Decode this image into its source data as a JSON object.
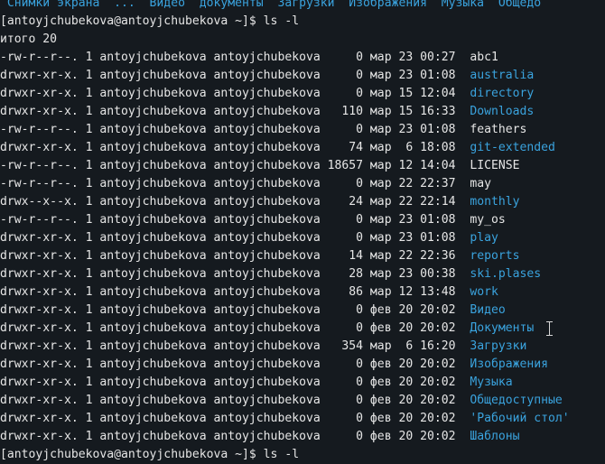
{
  "prev_line": " Снимки экрана  ...  Видео  документы  Загрузки  Изображения  Музыка  Общедо",
  "prompt": "[antoyjchubekova@antoyjchubekova ~]$ ls -l",
  "total": "итого 20",
  "rows": [
    {
      "meta": "-rw-r--r--. 1 antoyjchubekova antoyjchubekova     0 мар 23 00:27",
      "name": "abc1",
      "type": "file"
    },
    {
      "meta": "drwxr-xr-x. 1 antoyjchubekova antoyjchubekova     0 мар 23 01:08",
      "name": "australia",
      "type": "dir"
    },
    {
      "meta": "drwxr-xr-x. 1 antoyjchubekova antoyjchubekova     0 мар 15 12:04",
      "name": "directory",
      "type": "dir"
    },
    {
      "meta": "drwxr-xr-x. 1 antoyjchubekova antoyjchubekova   110 мар 15 16:33",
      "name": "Downloads",
      "type": "dir"
    },
    {
      "meta": "-rw-r--r--. 1 antoyjchubekova antoyjchubekova     0 мар 23 01:08",
      "name": "feathers",
      "type": "file"
    },
    {
      "meta": "drwxr-xr-x. 1 antoyjchubekova antoyjchubekova    74 мар  6 18:08",
      "name": "git-extended",
      "type": "dir"
    },
    {
      "meta": "-rw-r--r--. 1 antoyjchubekova antoyjchubekova 18657 мар 12 14:04",
      "name": "LICENSE",
      "type": "file"
    },
    {
      "meta": "-rw-r--r--. 1 antoyjchubekova antoyjchubekova     0 мар 22 22:37",
      "name": "may",
      "type": "file"
    },
    {
      "meta": "drwx--x--x. 1 antoyjchubekova antoyjchubekova    24 мар 22 22:14",
      "name": "monthly",
      "type": "dir"
    },
    {
      "meta": "-rw-r--r--. 1 antoyjchubekova antoyjchubekova     0 мар 23 01:08",
      "name": "my_os",
      "type": "file"
    },
    {
      "meta": "drwxr-xr-x. 1 antoyjchubekova antoyjchubekova     0 мар 23 01:08",
      "name": "play",
      "type": "dir"
    },
    {
      "meta": "drwxr-xr-x. 1 antoyjchubekova antoyjchubekova    14 мар 22 22:36",
      "name": "reports",
      "type": "dir"
    },
    {
      "meta": "drwxr-xr-x. 1 antoyjchubekova antoyjchubekova    28 мар 23 00:38",
      "name": "ski.plases",
      "type": "dir"
    },
    {
      "meta": "drwxr-xr-x. 1 antoyjchubekova antoyjchubekova    86 мар 12 13:48",
      "name": "work",
      "type": "dir"
    },
    {
      "meta": "drwxr-xr-x. 1 antoyjchubekova antoyjchubekova     0 фев 20 20:02",
      "name": "Видео",
      "type": "dir"
    },
    {
      "meta": "drwxr-xr-x. 1 antoyjchubekova antoyjchubekova     0 фев 20 20:02",
      "name": "Документы",
      "type": "dir"
    },
    {
      "meta": "drwxr-xr-x. 1 antoyjchubekova antoyjchubekova   354 мар  6 16:20",
      "name": "Загрузки",
      "type": "dir"
    },
    {
      "meta": "drwxr-xr-x. 1 antoyjchubekova antoyjchubekova     0 фев 20 20:02",
      "name": "Изображения",
      "type": "dir"
    },
    {
      "meta": "drwxr-xr-x. 1 antoyjchubekova antoyjchubekova     0 фев 20 20:02",
      "name": "Музыка",
      "type": "dir"
    },
    {
      "meta": "drwxr-xr-x. 1 antoyjchubekova antoyjchubekova     0 фев 20 20:02",
      "name": "Общедоступные",
      "type": "dir"
    },
    {
      "meta": "drwxr-xr-x. 1 antoyjchubekova antoyjchubekova     0 фев 20 20:02",
      "name": "'Рабочий стол'",
      "type": "dir"
    },
    {
      "meta": "drwxr-xr-x. 1 antoyjchubekova antoyjchubekova     0 фев 20 20:02",
      "name": "Шаблоны",
      "type": "dir"
    }
  ],
  "next_prompt": "[antoyjchubekova@antoyjchubekova ~]$ ls -l",
  "colors": {
    "background": "#151a1f",
    "text": "#e6e6e6",
    "directory": "#3aa3de"
  },
  "icons": {
    "mouse_cursor": "text-cursor-icon"
  }
}
